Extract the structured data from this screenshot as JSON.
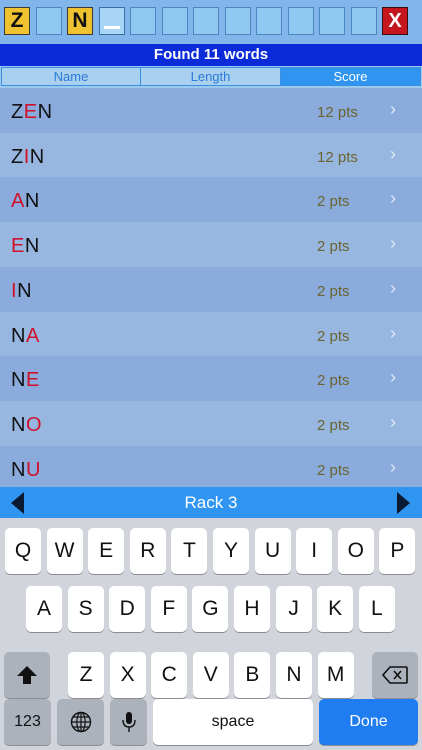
{
  "rack": {
    "tiles": [
      {
        "letter": "Z"
      },
      {
        "letter": ""
      },
      {
        "letter": "N"
      },
      {
        "letter": ""
      },
      {
        "letter": ""
      },
      {
        "letter": ""
      },
      {
        "letter": ""
      },
      {
        "letter": ""
      },
      {
        "letter": ""
      },
      {
        "letter": ""
      },
      {
        "letter": ""
      },
      {
        "letter": ""
      }
    ],
    "clear_label": "X"
  },
  "banner": {
    "text": "Found 11 words"
  },
  "sort": {
    "options": [
      {
        "label": "Name"
      },
      {
        "label": "Length"
      },
      {
        "label": "Score"
      }
    ],
    "selected": "Score"
  },
  "words": [
    {
      "parts": [
        {
          "t": "Z",
          "red": false
        },
        {
          "t": "E",
          "red": true
        },
        {
          "t": "N",
          "red": false
        }
      ],
      "pts": "12 pts"
    },
    {
      "parts": [
        {
          "t": "Z",
          "red": false
        },
        {
          "t": "I",
          "red": true
        },
        {
          "t": "N",
          "red": false
        }
      ],
      "pts": "12 pts"
    },
    {
      "parts": [
        {
          "t": "A",
          "red": true
        },
        {
          "t": "N",
          "red": false
        }
      ],
      "pts": "2 pts"
    },
    {
      "parts": [
        {
          "t": "E",
          "red": true
        },
        {
          "t": "N",
          "red": false
        }
      ],
      "pts": "2 pts"
    },
    {
      "parts": [
        {
          "t": "I",
          "red": true
        },
        {
          "t": "N",
          "red": false
        }
      ],
      "pts": "2 pts"
    },
    {
      "parts": [
        {
          "t": "N",
          "red": false
        },
        {
          "t": "A",
          "red": true
        }
      ],
      "pts": "2 pts"
    },
    {
      "parts": [
        {
          "t": "N",
          "red": false
        },
        {
          "t": "E",
          "red": true
        }
      ],
      "pts": "2 pts"
    },
    {
      "parts": [
        {
          "t": "N",
          "red": false
        },
        {
          "t": "O",
          "red": true
        }
      ],
      "pts": "2 pts"
    },
    {
      "parts": [
        {
          "t": "N",
          "red": false
        },
        {
          "t": "U",
          "red": true
        }
      ],
      "pts": "2 pts"
    }
  ],
  "row_colors": [
    "#8aabdb",
    "#97b7e1"
  ],
  "chevron": "›",
  "rack_nav": {
    "label": "Rack 3"
  },
  "keyboard": {
    "row1": [
      "Q",
      "W",
      "E",
      "R",
      "T",
      "Y",
      "U",
      "I",
      "O",
      "P"
    ],
    "row2": [
      "A",
      "S",
      "D",
      "F",
      "G",
      "H",
      "J",
      "K",
      "L"
    ],
    "row3": [
      "Z",
      "X",
      "C",
      "V",
      "B",
      "N",
      "M"
    ],
    "shift_icon": "shift-icon",
    "delete_icon": "backspace-icon",
    "numbers_label": "123",
    "globe_icon": "globe-icon",
    "mic_icon": "microphone-icon",
    "space_label": "space",
    "done_label": "Done"
  }
}
